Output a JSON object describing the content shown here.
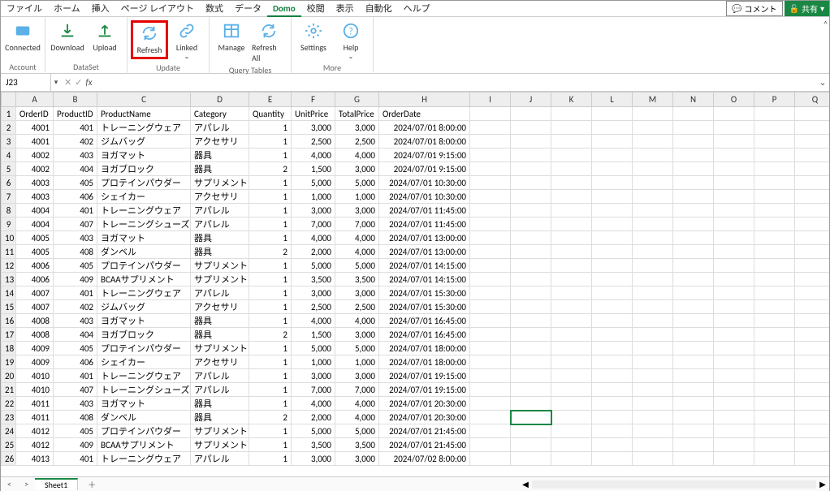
{
  "header": {
    "menu": [
      "ファイル",
      "ホーム",
      "挿入",
      "ページ レイアウト",
      "数式",
      "データ",
      "Domo",
      "校閲",
      "表示",
      "自動化",
      "ヘルプ"
    ],
    "activeMenu": "Domo",
    "comment": "コメント",
    "share": "共有"
  },
  "ribbon": {
    "groups": [
      {
        "label": "Account",
        "buttons": [
          {
            "name": "connected-button",
            "label": "Connected",
            "icon": "domo"
          }
        ]
      },
      {
        "label": "DataSet",
        "buttons": [
          {
            "name": "download-button",
            "label": "Download",
            "icon": "download"
          },
          {
            "name": "upload-button",
            "label": "Upload",
            "icon": "upload"
          }
        ]
      },
      {
        "label": "Update",
        "buttons": [
          {
            "name": "refresh-button",
            "label": "Refresh",
            "icon": "refresh",
            "highlighted": true
          },
          {
            "name": "linked-button",
            "label": "Linked",
            "icon": "link",
            "dropdown": true
          }
        ]
      },
      {
        "label": "Query Tables",
        "buttons": [
          {
            "name": "manage-button",
            "label": "Manage",
            "icon": "table"
          },
          {
            "name": "refresh-all-button",
            "label": "Refresh All",
            "icon": "refresh-all"
          }
        ]
      },
      {
        "label": "More",
        "buttons": [
          {
            "name": "settings-button",
            "label": "Settings",
            "icon": "gear"
          },
          {
            "name": "help-button",
            "label": "Help",
            "icon": "help",
            "dropdown": true
          }
        ]
      }
    ]
  },
  "formulaBar": {
    "nameBox": "J23",
    "fx": "fx"
  },
  "columns": [
    "A",
    "B",
    "C",
    "D",
    "E",
    "F",
    "G",
    "H",
    "I",
    "J",
    "K",
    "L",
    "M",
    "N",
    "O",
    "P",
    "Q"
  ],
  "colWidths": [
    "col-A",
    "col-B",
    "col-C",
    "col-D",
    "col-E",
    "col-F",
    "col-G",
    "col-H",
    "col-rest",
    "col-rest",
    "col-rest",
    "col-rest",
    "col-rest",
    "col-rest",
    "col-rest",
    "col-rest",
    "col-rest"
  ],
  "headers": [
    "OrderID",
    "ProductID",
    "ProductName",
    "Category",
    "Quantity",
    "UnitPrice",
    "TotalPrice",
    "OrderDate"
  ],
  "rows": [
    {
      "r": 2,
      "d": [
        "4001",
        "401",
        "トレーニングウェア",
        "アパレル",
        "1",
        "3,000",
        "3,000",
        "2024/07/01 8:00:00"
      ]
    },
    {
      "r": 3,
      "d": [
        "4001",
        "402",
        "ジムバッグ",
        "アクセサリ",
        "1",
        "2,500",
        "2,500",
        "2024/07/01 8:00:00"
      ]
    },
    {
      "r": 4,
      "d": [
        "4002",
        "403",
        "ヨガマット",
        "器具",
        "1",
        "4,000",
        "4,000",
        "2024/07/01 9:15:00"
      ]
    },
    {
      "r": 5,
      "d": [
        "4002",
        "404",
        "ヨガブロック",
        "器具",
        "2",
        "1,500",
        "3,000",
        "2024/07/01 9:15:00"
      ]
    },
    {
      "r": 6,
      "d": [
        "4003",
        "405",
        "プロテインパウダー",
        "サプリメント",
        "1",
        "5,000",
        "5,000",
        "2024/07/01 10:30:00"
      ]
    },
    {
      "r": 7,
      "d": [
        "4003",
        "406",
        "シェイカー",
        "アクセサリ",
        "1",
        "1,000",
        "1,000",
        "2024/07/01 10:30:00"
      ]
    },
    {
      "r": 8,
      "d": [
        "4004",
        "401",
        "トレーニングウェア",
        "アパレル",
        "1",
        "3,000",
        "3,000",
        "2024/07/01 11:45:00"
      ]
    },
    {
      "r": 9,
      "d": [
        "4004",
        "407",
        "トレーニングシューズ",
        "アパレル",
        "1",
        "7,000",
        "7,000",
        "2024/07/01 11:45:00"
      ]
    },
    {
      "r": 10,
      "d": [
        "4005",
        "403",
        "ヨガマット",
        "器具",
        "1",
        "4,000",
        "4,000",
        "2024/07/01 13:00:00"
      ]
    },
    {
      "r": 11,
      "d": [
        "4005",
        "408",
        "ダンベル",
        "器具",
        "2",
        "2,000",
        "4,000",
        "2024/07/01 13:00:00"
      ]
    },
    {
      "r": 12,
      "d": [
        "4006",
        "405",
        "プロテインパウダー",
        "サプリメント",
        "1",
        "5,000",
        "5,000",
        "2024/07/01 14:15:00"
      ]
    },
    {
      "r": 13,
      "d": [
        "4006",
        "409",
        "BCAAサプリメント",
        "サプリメント",
        "1",
        "3,500",
        "3,500",
        "2024/07/01 14:15:00"
      ]
    },
    {
      "r": 14,
      "d": [
        "4007",
        "401",
        "トレーニングウェア",
        "アパレル",
        "1",
        "3,000",
        "3,000",
        "2024/07/01 15:30:00"
      ]
    },
    {
      "r": 15,
      "d": [
        "4007",
        "402",
        "ジムバッグ",
        "アクセサリ",
        "1",
        "2,500",
        "2,500",
        "2024/07/01 15:30:00"
      ]
    },
    {
      "r": 16,
      "d": [
        "4008",
        "403",
        "ヨガマット",
        "器具",
        "1",
        "4,000",
        "4,000",
        "2024/07/01 16:45:00"
      ]
    },
    {
      "r": 17,
      "d": [
        "4008",
        "404",
        "ヨガブロック",
        "器具",
        "2",
        "1,500",
        "3,000",
        "2024/07/01 16:45:00"
      ]
    },
    {
      "r": 18,
      "d": [
        "4009",
        "405",
        "プロテインパウダー",
        "サプリメント",
        "1",
        "5,000",
        "5,000",
        "2024/07/01 18:00:00"
      ]
    },
    {
      "r": 19,
      "d": [
        "4009",
        "406",
        "シェイカー",
        "アクセサリ",
        "1",
        "1,000",
        "1,000",
        "2024/07/01 18:00:00"
      ]
    },
    {
      "r": 20,
      "d": [
        "4010",
        "401",
        "トレーニングウェア",
        "アパレル",
        "1",
        "3,000",
        "3,000",
        "2024/07/01 19:15:00"
      ]
    },
    {
      "r": 21,
      "d": [
        "4010",
        "407",
        "トレーニングシューズ",
        "アパレル",
        "1",
        "7,000",
        "7,000",
        "2024/07/01 19:15:00"
      ]
    },
    {
      "r": 22,
      "d": [
        "4011",
        "403",
        "ヨガマット",
        "器具",
        "1",
        "4,000",
        "4,000",
        "2024/07/01 20:30:00"
      ]
    },
    {
      "r": 23,
      "d": [
        "4011",
        "408",
        "ダンベル",
        "器具",
        "2",
        "2,000",
        "4,000",
        "2024/07/01 20:30:00"
      ]
    },
    {
      "r": 24,
      "d": [
        "4012",
        "405",
        "プロテインパウダー",
        "サプリメント",
        "1",
        "5,000",
        "5,000",
        "2024/07/01 21:45:00"
      ]
    },
    {
      "r": 25,
      "d": [
        "4012",
        "409",
        "BCAAサプリメント",
        "サプリメント",
        "1",
        "3,500",
        "3,500",
        "2024/07/01 21:45:00"
      ]
    },
    {
      "r": 26,
      "d": [
        "4013",
        "401",
        "トレーニングウェア",
        "アパレル",
        "1",
        "3,000",
        "3,000",
        "2024/07/02 8:00:00"
      ]
    }
  ],
  "numericCols": [
    0,
    1,
    4,
    5,
    6
  ],
  "rightCols": [
    7
  ],
  "selected": {
    "row": 23,
    "col": "J"
  },
  "footer": {
    "tab": "Sheet1"
  }
}
